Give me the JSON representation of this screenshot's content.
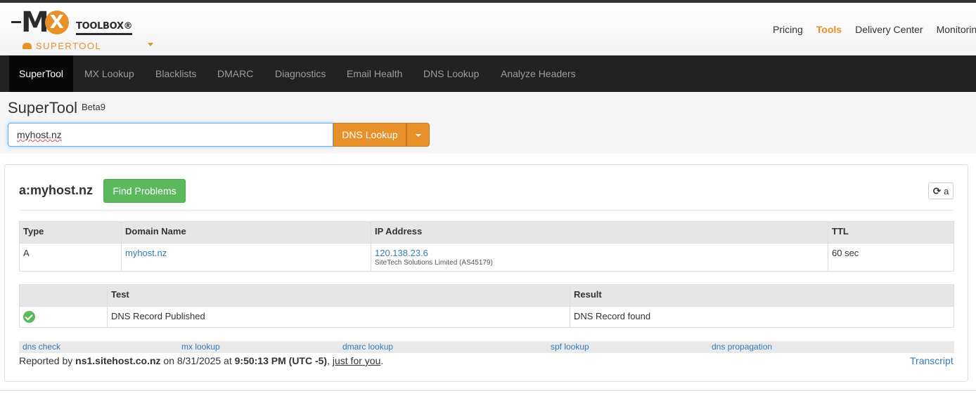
{
  "brand": {
    "logo_m": "M",
    "logo_x": "X",
    "logo_toolbox": "TOOLBOX®",
    "supertool": "SUPERTOOL"
  },
  "topnav": [
    "Pricing",
    "Tools",
    "Delivery Center",
    "Monitoring"
  ],
  "navbar": [
    "SuperTool",
    "MX Lookup",
    "Blacklists",
    "DMARC",
    "Diagnostics",
    "Email Health",
    "DNS Lookup",
    "Analyze Headers"
  ],
  "search": {
    "title": "SuperTool",
    "beta": "Beta9",
    "value": "myhost.nz",
    "button": "DNS Lookup"
  },
  "result": {
    "title": "a:myhost.nz",
    "find_problems": "Find Problems",
    "refresh_label": "a",
    "records_headers": [
      "Type",
      "Domain Name",
      "IP Address",
      "TTL"
    ],
    "records": [
      {
        "type": "A",
        "domain": "myhost.nz",
        "ip": "120.138.23.6",
        "asn": "SiteTech Solutions Limited (AS45179)",
        "ttl": "60 sec"
      }
    ],
    "tests_headers": [
      "",
      "Test",
      "Result"
    ],
    "tests": [
      {
        "status": "ok",
        "test": "DNS Record Published",
        "result": "DNS Record found"
      }
    ],
    "links": [
      "dns check",
      "mx lookup",
      "dmarc lookup",
      "spf lookup",
      "dns propagation"
    ],
    "reported": {
      "prefix": "Reported by ",
      "server": "ns1.sitehost.co.nz",
      "on": " on 8/31/2025 at ",
      "time": "9:50:13 PM (UTC -5)",
      "sep": ", ",
      "just": "just for you",
      "end": "."
    },
    "transcript": "Transcript"
  },
  "colors": {
    "accent": "#e8902a",
    "success": "#5cb85c",
    "link": "#337ab7",
    "navbar": "#222222"
  }
}
